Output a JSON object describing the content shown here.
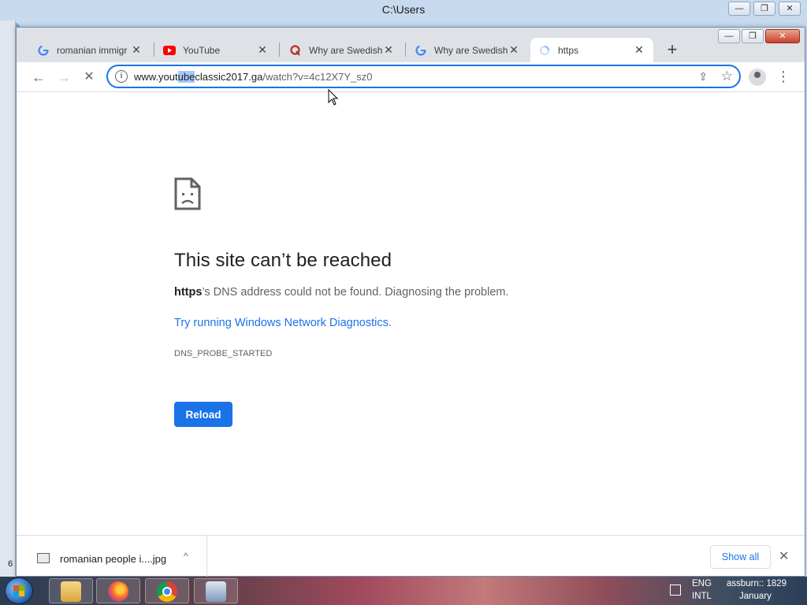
{
  "background_window": {
    "title": "C:\\Users",
    "controls": [
      "—",
      "❐",
      "✕"
    ],
    "left_mark": "6"
  },
  "chrome": {
    "window_controls": [
      "—",
      "❐",
      "✕"
    ],
    "tabs": [
      {
        "label": "romanian immigr",
        "favicon": "google-icon",
        "close": "✕"
      },
      {
        "label": "YouTube",
        "favicon": "youtube-icon",
        "close": "✕"
      },
      {
        "label": "Why are Swedish",
        "favicon": "quora-icon",
        "close": "✕"
      },
      {
        "label": "Why are Swedish",
        "favicon": "google-icon",
        "close": "✕"
      },
      {
        "label": "https",
        "favicon": "loading-spinner-icon",
        "close": "✕"
      }
    ],
    "new_tab": "+",
    "toolbar": {
      "back": "←",
      "forward": "→",
      "stop": "✕",
      "info": "i",
      "url_prefix": "www.yout",
      "url_selected": "ube",
      "url_host_rest": "classic2017.ga",
      "url_path": "/watch?v=4c12X7Y_sz0",
      "share": "⇪",
      "star": "☆",
      "menu": "⋮"
    }
  },
  "error_page": {
    "title": "This site can’t be reached",
    "host_bold": "https",
    "description_rest": "’s DNS address could not be found. Diagnosing the problem.",
    "link_text": "Try running Windows Network Diagnostics",
    "link_period": ".",
    "error_code": "DNS_PROBE_STARTED",
    "reload_label": "Reload"
  },
  "download_shelf": {
    "file_name": "romanian people i....jpg",
    "chevron": "^",
    "show_all_label": "Show all",
    "close": "✕"
  },
  "taskbar": {
    "lang_top": "ENG",
    "lang_bottom": "INTL",
    "clock_top": "assburn:: 1829",
    "clock_bottom": "January"
  },
  "colors": {
    "accent_blue": "#1a73e8",
    "tabstrip_bg": "#dee1e6",
    "text_primary": "#202124",
    "text_secondary": "#5f6368"
  }
}
